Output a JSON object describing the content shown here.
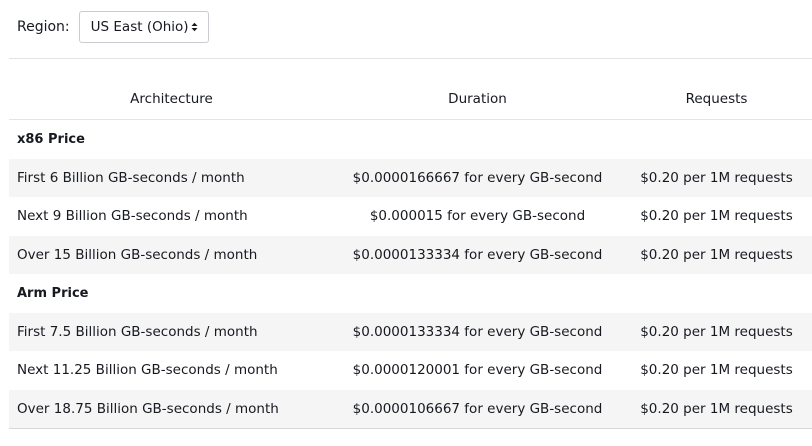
{
  "region": {
    "label": "Region:",
    "selected": "US East (Ohio)"
  },
  "table": {
    "headers": {
      "architecture": "Architecture",
      "duration": "Duration",
      "requests": "Requests"
    },
    "groups": [
      {
        "title": "x86 Price",
        "rows": [
          {
            "tier": "First 6 Billion GB-seconds / month",
            "duration": "$0.0000166667 for every GB-second",
            "requests": "$0.20 per 1M requests"
          },
          {
            "tier": "Next 9 Billion GB-seconds / month",
            "duration": "$0.000015 for every GB-second",
            "requests": "$0.20 per 1M requests"
          },
          {
            "tier": "Over 15 Billion GB-seconds / month",
            "duration": "$0.0000133334 for every GB-second",
            "requests": "$0.20 per 1M requests"
          }
        ]
      },
      {
        "title": "Arm Price",
        "rows": [
          {
            "tier": "First 7.5 Billion GB-seconds / month",
            "duration": "$0.0000133334 for every GB-second",
            "requests": "$0.20 per 1M requests"
          },
          {
            "tier": "Next 11.25 Billion GB-seconds / month",
            "duration": "$0.0000120001 for every GB-second",
            "requests": "$0.20 per 1M requests"
          },
          {
            "tier": "Over 18.75 Billion GB-seconds / month",
            "duration": "$0.0000106667 for every GB-second",
            "requests": "$0.20 per 1M requests"
          }
        ]
      }
    ]
  },
  "colors": {
    "row_shade": "#f5f5f5",
    "divider": "#e3e4e6",
    "text": "#16191f"
  },
  "icons": {
    "select_chevron": "chevron-up-down-icon"
  }
}
